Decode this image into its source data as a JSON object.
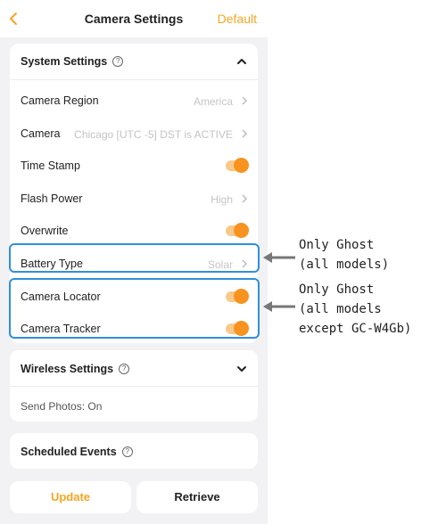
{
  "header": {
    "back_glyph": "<",
    "title": "Camera Settings",
    "default_label": "Default"
  },
  "system": {
    "title": "System Settings",
    "rows": [
      {
        "label": "Camera Region",
        "value": "America"
      },
      {
        "label": "Camera",
        "value": "Chicago [UTC -5] DST is ACTIVE"
      },
      {
        "label": "Time Stamp",
        "toggle": true
      },
      {
        "label": "Flash Power",
        "value": "High"
      },
      {
        "label": "Overwrite",
        "toggle": true
      },
      {
        "label": "Battery Type",
        "value": "Solar"
      },
      {
        "label": "Camera Locator",
        "toggle": true
      },
      {
        "label": "Camera Tracker",
        "toggle": true
      }
    ]
  },
  "wireless": {
    "title": "Wireless Settings",
    "send_photos": "Send Photos: On"
  },
  "scheduled": {
    "title": "Scheduled Events"
  },
  "buttons": {
    "update": "Update",
    "retrieve": "Retrieve"
  },
  "annotations": {
    "note1_line1": "Only Ghost",
    "note1_line2": "(all models)",
    "note2_line1": "Only Ghost",
    "note2_line2": "(all models",
    "note2_line3": "except GC-W4Gb)"
  },
  "colors": {
    "accent": "#f5a623",
    "toggle_knob": "#f7931e",
    "highlight": "#2f8fdc"
  }
}
